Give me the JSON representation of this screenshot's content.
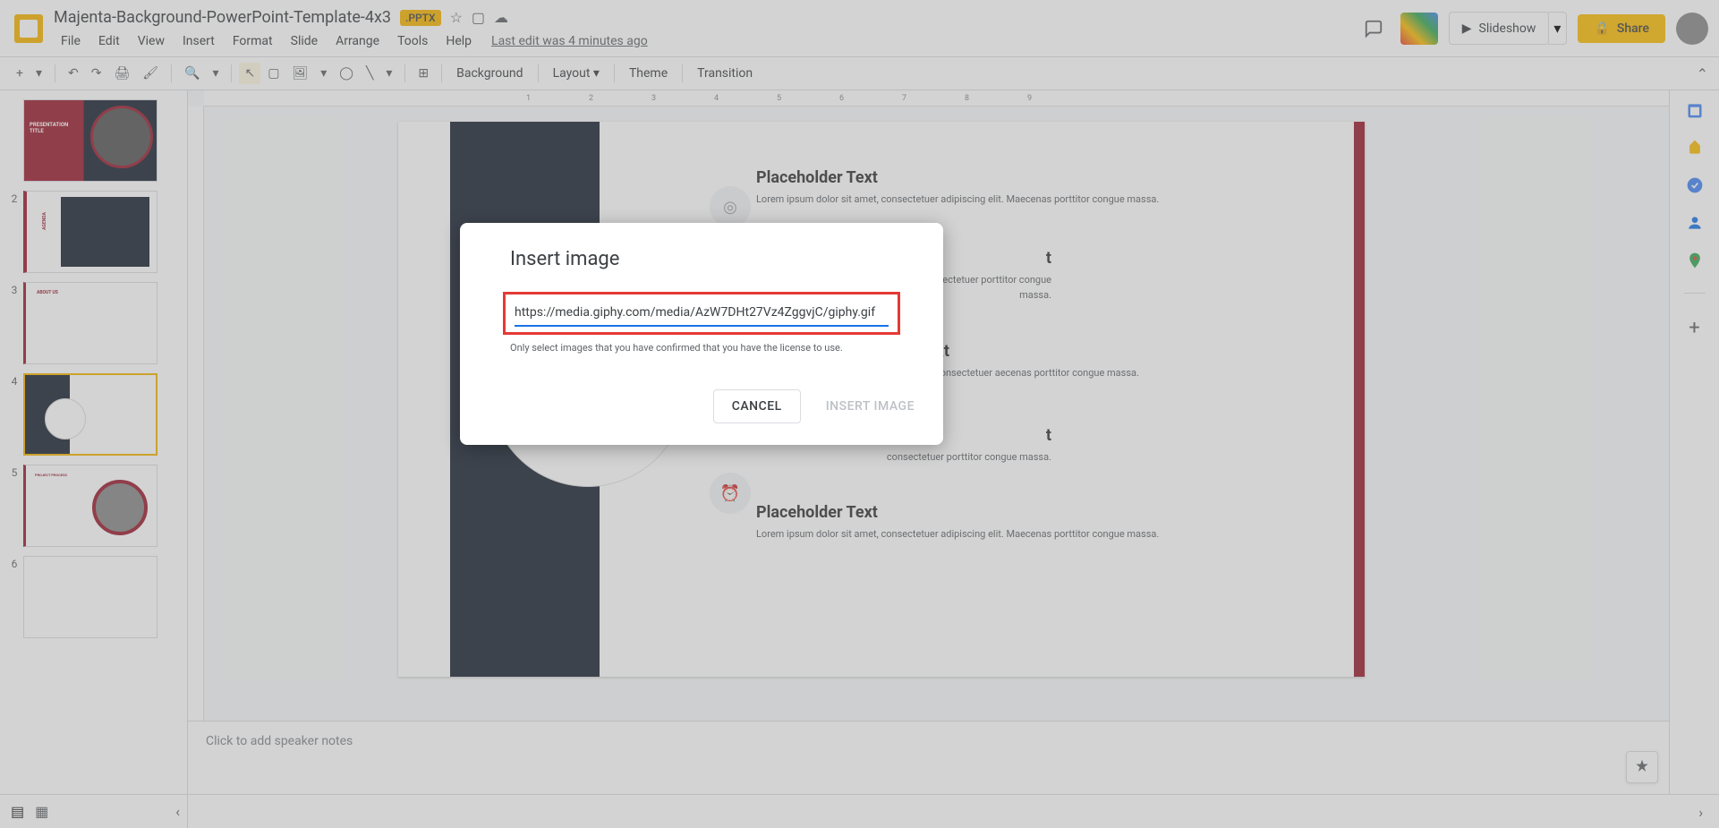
{
  "header": {
    "doc_title": "Majenta-Background-PowerPoint-Template-4x3",
    "badge": ".PPTX",
    "last_edit": "Last edit was 4 minutes ago",
    "menu": {
      "file": "File",
      "edit": "Edit",
      "view": "View",
      "insert": "Insert",
      "format": "Format",
      "slide": "Slide",
      "arrange": "Arrange",
      "tools": "Tools",
      "help": "Help"
    },
    "slideshow": "Slideshow",
    "share": "Share"
  },
  "toolbar": {
    "background": "Background",
    "layout": "Layout",
    "theme": "Theme",
    "transition": "Transition"
  },
  "filmstrip": {
    "nums": [
      "",
      "2",
      "3",
      "4",
      "5",
      "6"
    ],
    "thumb2_label": "AGENDA"
  },
  "ruler": {
    "ticks": [
      "1",
      "2",
      "3",
      "4",
      "5",
      "6",
      "7",
      "8",
      "9"
    ]
  },
  "slide": {
    "ph_title": "Placeholder Text",
    "ph_body": "Lorem ipsum dolor sit amet, consectetuer adipiscing elit. Maecenas porttitor congue massa.",
    "ph_title2": "r Text",
    "ph_body2": "amet, consectetuer\naecenas porttitor congue massa.",
    "ph_title3": "t",
    "ph_body3": "consectetuer\nporttitor congue massa."
  },
  "notes": {
    "placeholder": "Click to add speaker notes"
  },
  "modal": {
    "title": "Insert image",
    "url": "https://media.giphy.com/media/AzW7DHt27Vz4ZggvjC/giphy.gif",
    "hint": "Only select images that you have confirmed that you have the license to use.",
    "cancel": "CANCEL",
    "insert": "INSERT IMAGE"
  }
}
